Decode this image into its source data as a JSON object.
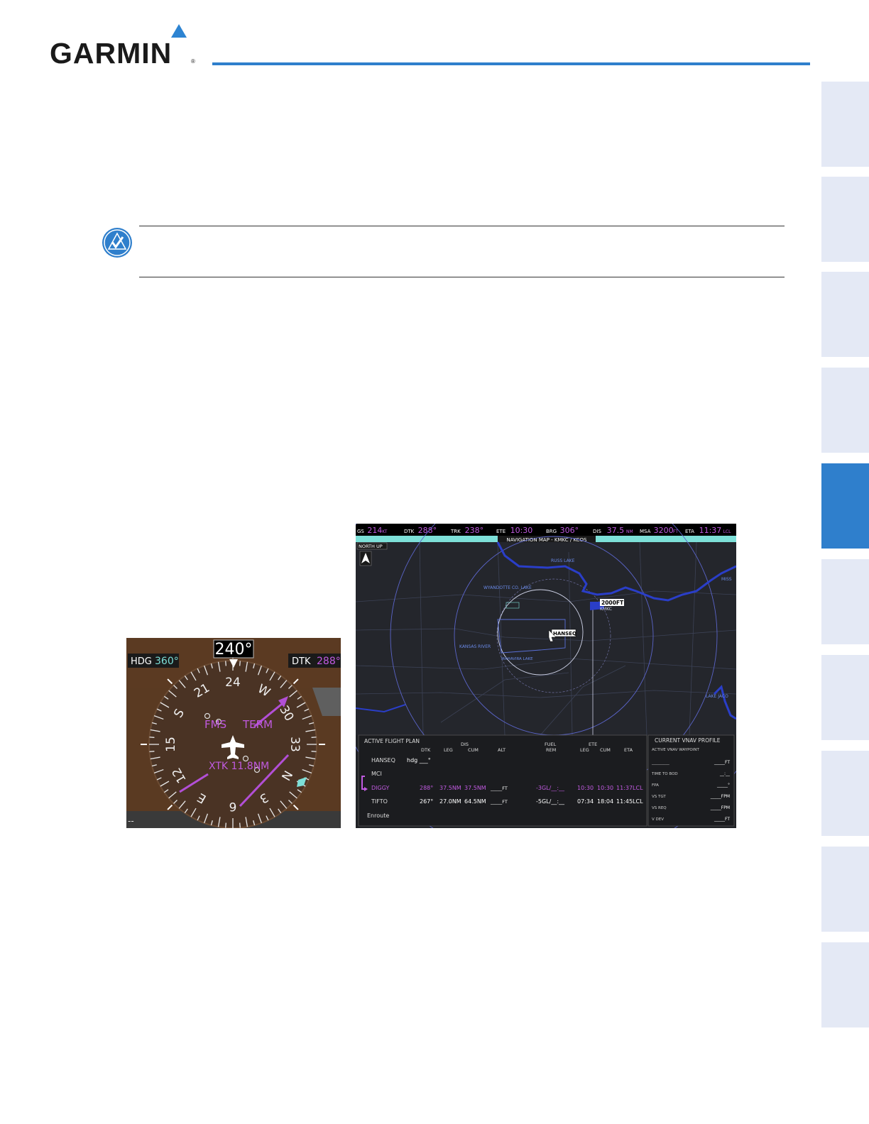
{
  "header": {
    "brand": "GARMIN",
    "registered": "®"
  },
  "hsi": {
    "heading_readout": "240°",
    "hdg_label": "HDG",
    "hdg_value": "360°",
    "dtk_label": "DTK",
    "dtk_value": "288°",
    "fms_label": "FMS",
    "term_label": "TERM",
    "xtk_label": "XTK 11.8NM",
    "bottom_left": "--",
    "compass_labels": [
      "24",
      "W",
      "30",
      "33",
      "N",
      "3",
      "6",
      "E",
      "12",
      "15",
      "S",
      "21"
    ]
  },
  "mfd": {
    "top_bar": [
      {
        "label": "GS",
        "value": "214",
        "unit": "KT"
      },
      {
        "label": "DTK",
        "value": "288°",
        "unit": ""
      },
      {
        "label": "TRK",
        "value": "238°",
        "unit": ""
      },
      {
        "label": "ETE",
        "value": "10:30",
        "unit": ""
      },
      {
        "label": "BRG",
        "value": "306°",
        "unit": ""
      },
      {
        "label": "DIS",
        "value": "37.5",
        "unit": "NM"
      },
      {
        "label": "MSA",
        "value": "3200",
        "unit": "FT"
      },
      {
        "label": "ETA",
        "value": "11:37",
        "unit": "LCL"
      }
    ],
    "map_title": "NAVIGATION MAP - KMKC / KCOS",
    "north_up": "NORTH UP",
    "map_labels": {
      "smithville": "RUSS LAKE",
      "wyandotte": "WYANDOTTE CO. LAKE",
      "kansas_river": "KANSAS RIVER",
      "shawnee": "MAHAVIRA LAKE",
      "lake_jacomo": "LAKE JACO",
      "missouri": "MISS",
      "alt_tag": "2000FT",
      "waypoint_tag": "HANSEQ",
      "kmci": "KMKC"
    },
    "fpl": {
      "title": "ACTIVE FLIGHT PLAN",
      "headers": {
        "dtk": "DTK",
        "dis": "DIS",
        "leg": "LEG",
        "cum": "CUM",
        "alt": "ALT",
        "fuel": "FUEL",
        "rem": "REM",
        "ete": "ETE",
        "ete_leg": "LEG",
        "ete_cum": "CUM",
        "eta": "ETA"
      },
      "rows": [
        {
          "wpt": "HANSEQ",
          "dtk": "hdg ___°",
          "leg": "",
          "cum": "",
          "alt": "",
          "rem": "",
          "ete_leg": "",
          "ete_cum": "",
          "eta": ""
        },
        {
          "wpt": "MCI",
          "dtk": "",
          "leg": "",
          "cum": "",
          "alt": "",
          "rem": "",
          "ete_leg": "",
          "ete_cum": "",
          "eta": ""
        },
        {
          "wpt": "DIGGY",
          "dtk": "288°",
          "leg": "37.5NM",
          "cum": "37.5NM",
          "alt": "_____FT",
          "rem": "-3GL/__:__",
          "ete_leg": "10:30",
          "ete_cum": "10:30",
          "eta": "11:37LCL"
        },
        {
          "wpt": "TIFTO",
          "dtk": "267°",
          "leg": "27.0NM",
          "cum": "64.5NM",
          "alt": "_____FT",
          "rem": "-5GL/__:__",
          "ete_leg": "07:34",
          "ete_cum": "18:04",
          "eta": "11:45LCL"
        },
        {
          "wpt": "Enroute",
          "dtk": "",
          "leg": "",
          "cum": "",
          "alt": "",
          "rem": "",
          "ete_leg": "",
          "ete_cum": "",
          "eta": ""
        }
      ]
    },
    "vnav": {
      "title": "CURRENT VNAV PROFILE",
      "active_label": "ACTIVE VNAV WAYPOINT",
      "rows": [
        {
          "label": "_________",
          "value": "_____FT"
        },
        {
          "label": "TIME TO BOD",
          "value": "__:__"
        },
        {
          "label": "FPA",
          "value": "_____°"
        },
        {
          "label": "VS TGT",
          "value": "_____FPM"
        },
        {
          "label": "VS REQ",
          "value": "_____FPM"
        },
        {
          "label": "V DEV",
          "value": "_____FT"
        }
      ]
    }
  },
  "colors": {
    "garmin_blue": "#2f7fcc",
    "tab_inactive": "#e4e9f5",
    "magenta": "#c05ae0",
    "cyan": "#7de0d8",
    "river_blue": "#2a3ec8"
  }
}
